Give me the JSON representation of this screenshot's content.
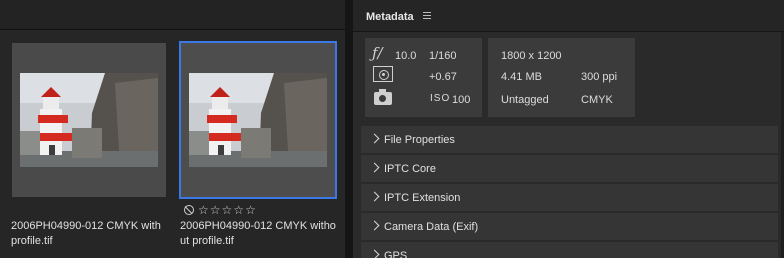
{
  "thumbnails": [
    {
      "filename": "2006PH04990-012 CMYK with profile.tif",
      "line1": "2006PH04990-012 CMYK with",
      "line2": "profile.tif",
      "selected": false
    },
    {
      "filename": "2006PH04990-012 CMYK without profile.tif",
      "line1": "2006PH04990-012 CMYK witho",
      "line2": "ut profile.tif",
      "selected": true
    }
  ],
  "rating": {
    "stars": 0,
    "max": 5,
    "star_glyph": "☆"
  },
  "metadata_panel": {
    "title": "Metadata",
    "menu_icon": "hamburger-menu-icon",
    "camera": {
      "aperture_symbol": "ƒ/",
      "aperture": "10.0",
      "shutter": "1/160",
      "exposure_comp": "+0.67",
      "iso_label": "ISO",
      "iso": "100"
    },
    "file": {
      "dimensions": "1800 x 1200",
      "size": "4.41 MB",
      "resolution": "300 ppi",
      "profile": "Untagged",
      "color_mode": "CMYK"
    },
    "sections": [
      "File Properties",
      "IPTC Core",
      "IPTC Extension",
      "Camera Data (Exif)",
      "GPS"
    ]
  },
  "colors": {
    "selection_accent": "#3a78e8",
    "panel_bg": "#2a2a2a",
    "section_bg": "#353535"
  }
}
